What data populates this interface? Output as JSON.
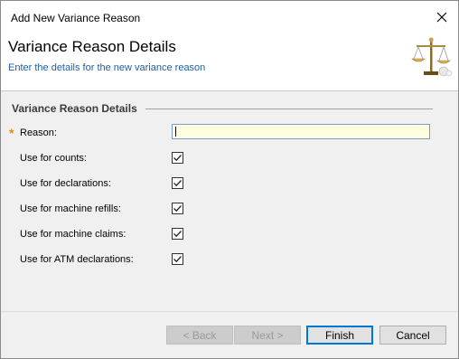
{
  "window": {
    "title": "Add New Variance Reason",
    "close_icon": "close-icon"
  },
  "header": {
    "title": "Variance Reason Details",
    "subtitle": "Enter the details for the new variance reason",
    "icon": "scales-icon"
  },
  "form": {
    "section_title": "Variance Reason Details",
    "required_marker": "*",
    "reason": {
      "label": "Reason:",
      "value": "",
      "placeholder": ""
    },
    "checkboxes": [
      {
        "label": "Use for counts:",
        "checked": true
      },
      {
        "label": "Use for declarations:",
        "checked": true
      },
      {
        "label": "Use for machine refills:",
        "checked": true
      },
      {
        "label": "Use for machine claims:",
        "checked": true
      },
      {
        "label": "Use for ATM declarations:",
        "checked": true
      }
    ]
  },
  "buttons": {
    "back": "< Back",
    "next": "Next >",
    "finish": "Finish",
    "cancel": "Cancel"
  },
  "colors": {
    "subtitle": "#1f5fa6",
    "required": "#e68a1a",
    "input_bg": "#fffde0",
    "panel_bg": "#f0f0f0"
  }
}
